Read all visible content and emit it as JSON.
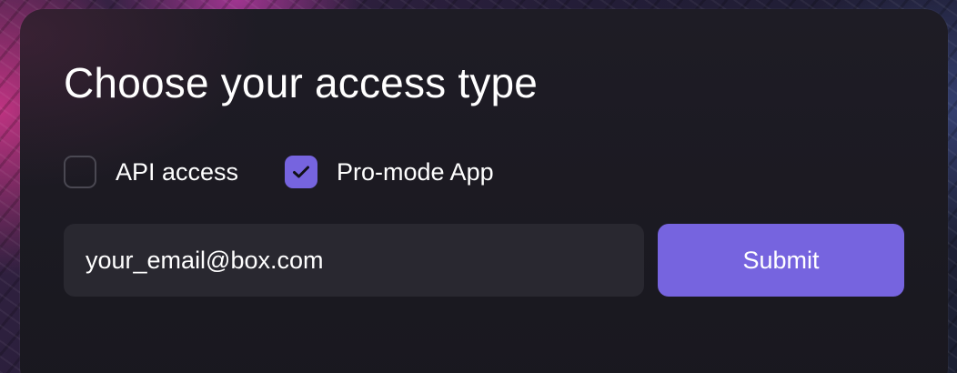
{
  "form": {
    "title": "Choose your access type",
    "options": [
      {
        "label": "API access",
        "checked": false
      },
      {
        "label": "Pro-mode App",
        "checked": true
      }
    ],
    "email": {
      "value": "your_email@box.com",
      "placeholder": ""
    },
    "submit_label": "Submit"
  },
  "colors": {
    "accent": "#7664df",
    "card_background": "#1b1a21",
    "input_background": "#292830",
    "text": "#ffffff"
  },
  "icons": {
    "checked_box": "checkmark-icon"
  }
}
